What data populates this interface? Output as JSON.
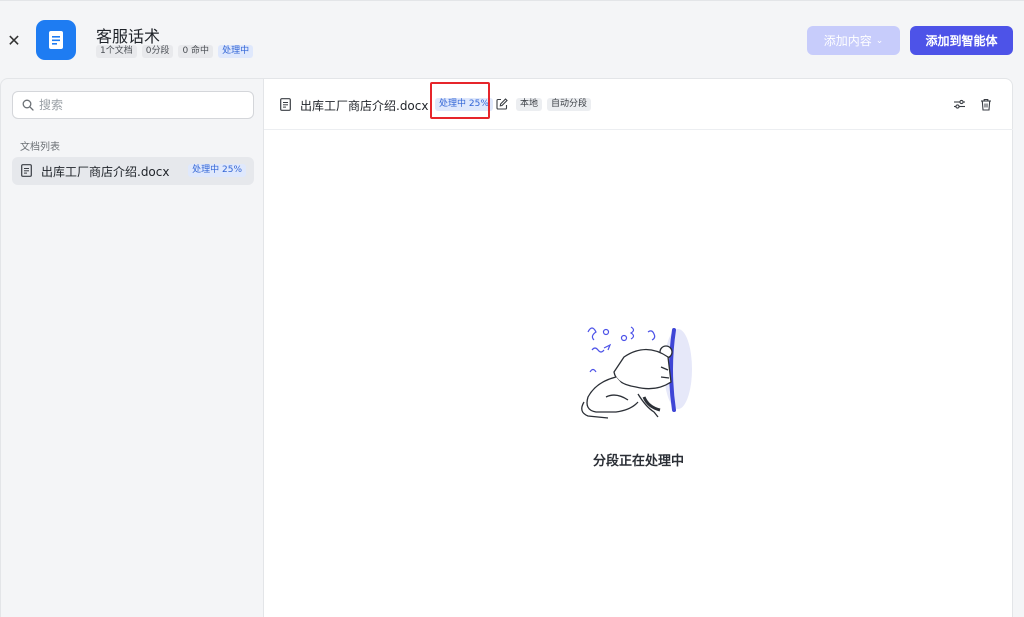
{
  "header": {
    "title": "客服话术",
    "tags": [
      {
        "label": "1个文档",
        "style": "gray"
      },
      {
        "label": "0分段",
        "style": "gray"
      },
      {
        "label": "0 命中",
        "style": "gray"
      },
      {
        "label": "处理中",
        "style": "blue"
      }
    ],
    "add_content_label": "添加内容",
    "add_to_agent_label": "添加到智能体"
  },
  "sidebar": {
    "search_placeholder": "搜索",
    "list_title": "文档列表",
    "items": [
      {
        "name": "出库工厂商店介绍.docx",
        "status": "处理中 25%"
      }
    ]
  },
  "main": {
    "doc_name": "出库工厂商店介绍.docx",
    "status": "处理中 25%",
    "source_tag": "本地",
    "segment_tag": "自动分段",
    "empty_message": "分段正在处理中"
  },
  "colors": {
    "primary": "#4d53e8",
    "primary_disabled": "#c7ccfb",
    "doc_icon_bg": "#1e7cf2",
    "status_bg": "#dfe8fc",
    "status_text": "#3366d6",
    "highlight": "#e6252b"
  },
  "icons": [
    "close-icon",
    "document-icon",
    "search-icon",
    "chevron-down-icon",
    "edit-icon",
    "settings-icon",
    "trash-icon"
  ]
}
